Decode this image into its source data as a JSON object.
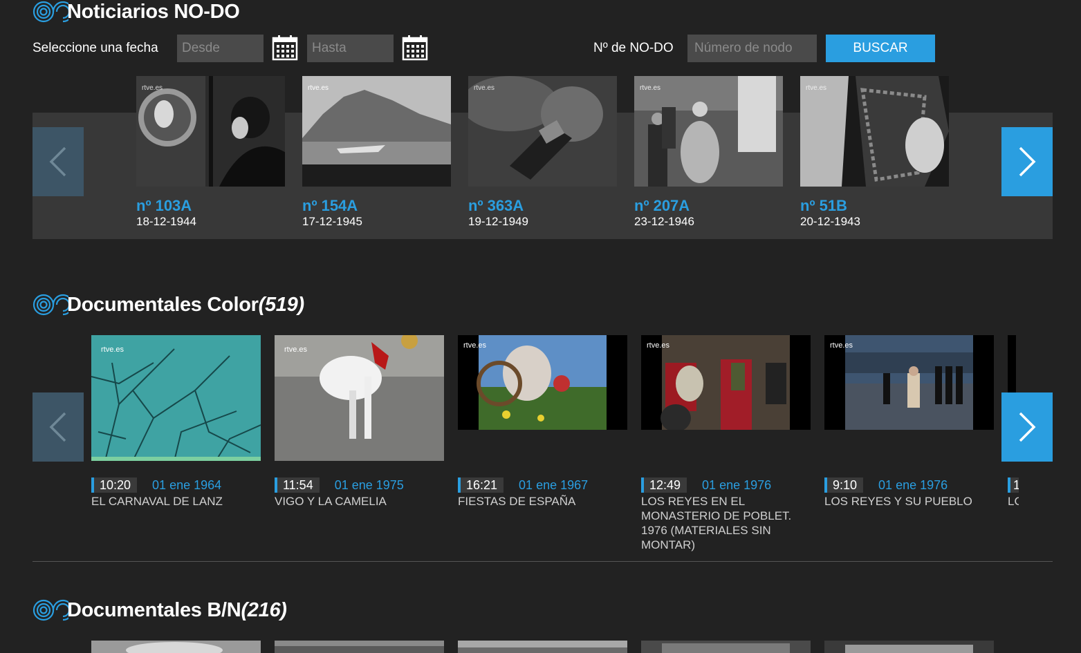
{
  "nodo_section": {
    "title": "Noticiarios NO-DO",
    "date_label": "Seleccione una fecha",
    "from_placeholder": "Desde",
    "to_placeholder": "Hasta",
    "number_label": "Nº de NO-DO",
    "number_placeholder": "Número de nodo",
    "search_label": "BUSCAR",
    "items": [
      {
        "number": "nº 103A",
        "date": "18-12-1944"
      },
      {
        "number": "nº 154A",
        "date": "17-12-1945"
      },
      {
        "number": "nº 363A",
        "date": "19-12-1949"
      },
      {
        "number": "nº 207A",
        "date": "23-12-1946"
      },
      {
        "number": "nº 51B",
        "date": "20-12-1943"
      }
    ]
  },
  "color_section": {
    "title": "Documentales Color",
    "count": "(519)",
    "items": [
      {
        "duration": "10:20",
        "date": "01 ene 1964",
        "title": "EL CARNAVAL DE LANZ"
      },
      {
        "duration": "11:54",
        "date": "01 ene 1975",
        "title": "VIGO Y LA CAMELIA"
      },
      {
        "duration": "16:21",
        "date": "01 ene 1967",
        "title": "FIESTAS DE ESPAÑA"
      },
      {
        "duration": "12:49",
        "date": "01 ene 1976",
        "title": "LOS REYES EN EL MONASTERIO DE POBLET. 1976 (MATERIALES SIN MONTAR)"
      },
      {
        "duration": "9:10",
        "date": "01 ene 1976",
        "title": "LOS REYES Y SU PUEBLO"
      }
    ],
    "partial_duration": "1",
    "partial_title": "LC"
  },
  "bn_section": {
    "title": "Documentales B/N",
    "count": "(216)"
  },
  "watermark": "rtve.es",
  "colors": {
    "accent": "#2a9ee0",
    "background": "#222222",
    "band": "#383838"
  },
  "icons": [
    "nodo-logo-icon",
    "calendar-icon",
    "chevron-left-icon",
    "chevron-right-icon"
  ]
}
